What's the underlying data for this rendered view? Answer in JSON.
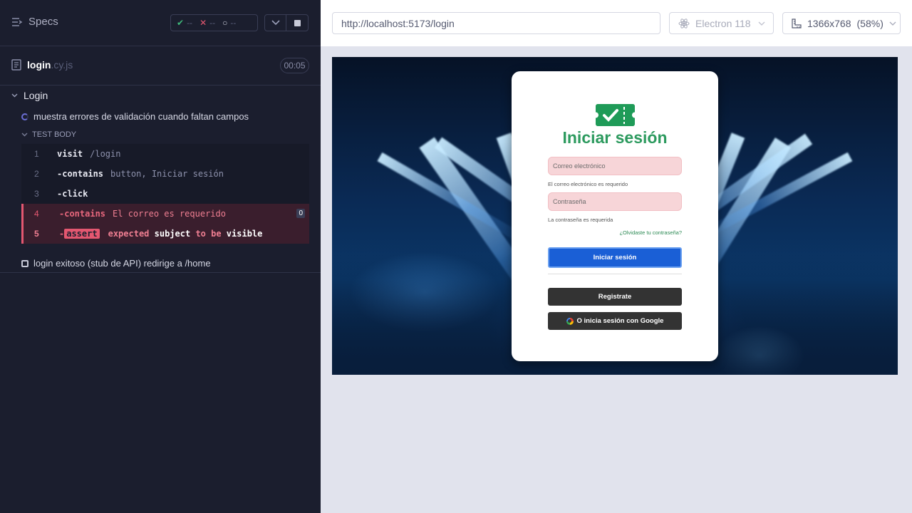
{
  "reporter": {
    "specs_label": "Specs",
    "stats": {
      "passed": "--",
      "failed": "--",
      "pending": "--"
    },
    "spec": {
      "name": "login",
      "ext": ".cy.js",
      "duration": "00:05"
    },
    "suite": "Login",
    "tests": [
      {
        "title": "muestra errores de validación cuando faltan campos",
        "section": "TEST BODY",
        "commands": [
          {
            "num": "1",
            "method": "visit",
            "msg": "/login"
          },
          {
            "num": "2",
            "method": "-contains",
            "msg": "button, Iniciar sesión"
          },
          {
            "num": "3",
            "method": "-click",
            "msg": ""
          },
          {
            "num": "4",
            "method": "-contains",
            "msg": "El correo es requerido",
            "count": "0"
          },
          {
            "num": "5",
            "method": "-",
            "badge": "assert",
            "parts": [
              "expected",
              "subject",
              "to be",
              "visible"
            ]
          }
        ]
      },
      {
        "title": "login exitoso (stub de API) redirige a /home"
      }
    ]
  },
  "aut": {
    "url": "http://localhost:5173/login",
    "browser": "Electron 118",
    "viewport": "1366x768",
    "scale": "(58%)"
  },
  "login_page": {
    "title": "Iniciar sesión",
    "email_placeholder": "Correo electrónico",
    "email_error": "El correo electrónico es requerido",
    "password_placeholder": "Contraseña",
    "password_error": "La contraseña es requerida",
    "forgot": "¿Olvidaste tu contraseña?",
    "submit": "Iniciar sesión",
    "register": "Registrate",
    "google": "O inicia sesión con Google"
  },
  "colors": {
    "reporter_bg": "#1b1e2e",
    "failed": "#e45770",
    "brand_green": "#2c9a5e",
    "primary_button": "#1a5fd6"
  }
}
